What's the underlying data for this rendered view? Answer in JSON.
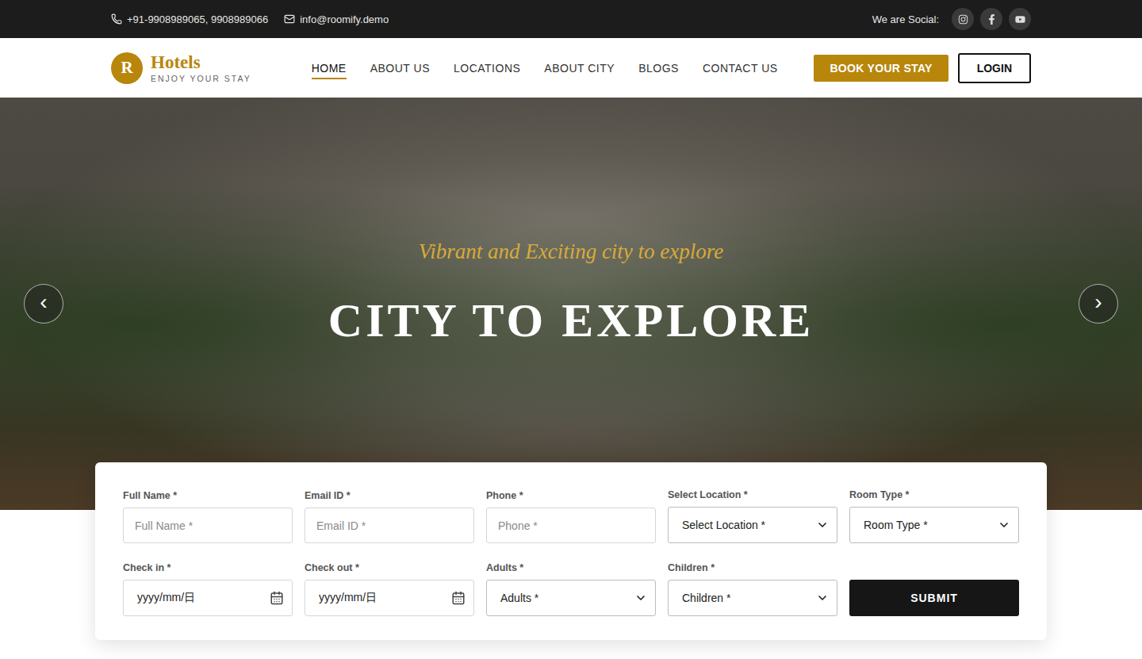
{
  "topbar": {
    "phone": "+91-9908989065, 9908989066",
    "email": "info@roomify.demo",
    "social_label": "We are Social:"
  },
  "logo": {
    "letter": "R",
    "name": "Hotels",
    "tagline": "ENJOY YOUR STAY"
  },
  "nav": [
    {
      "label": "HOME",
      "selected": true
    },
    {
      "label": "ABOUT US",
      "selected": false
    },
    {
      "label": "LOCATIONS",
      "selected": false
    },
    {
      "label": "ABOUT CITY",
      "selected": false
    },
    {
      "label": "BLOGS",
      "selected": false
    },
    {
      "label": "CONTACT US",
      "selected": false
    }
  ],
  "actions": {
    "book": "BOOK YOUR STAY",
    "login": "LOGIN"
  },
  "hero": {
    "subtitle": "Vibrant and Exciting city to explore",
    "title": "CITY TO EXPLORE",
    "prev": "‹",
    "next": "›"
  },
  "form": {
    "fields": [
      {
        "kind": "text",
        "label": "Full Name *",
        "placeholder": "Full Name *"
      },
      {
        "kind": "text",
        "label": "Email ID *",
        "placeholder": "Email ID *"
      },
      {
        "kind": "text",
        "label": "Phone *",
        "placeholder": "Phone *"
      },
      {
        "kind": "select",
        "label": "Select Location *",
        "placeholder": "Select Location *"
      },
      {
        "kind": "select",
        "label": "Room Type *",
        "placeholder": "Room Type *"
      },
      {
        "kind": "date",
        "label": "Check in *",
        "placeholder": "yyyy/mm/日"
      },
      {
        "kind": "date",
        "label": "Check out *",
        "placeholder": "yyyy/mm/日"
      },
      {
        "kind": "select",
        "label": "Adults *",
        "placeholder": "Adults *"
      },
      {
        "kind": "select",
        "label": "Children *",
        "placeholder": "Children *"
      }
    ],
    "submit": "SUBMIT"
  }
}
